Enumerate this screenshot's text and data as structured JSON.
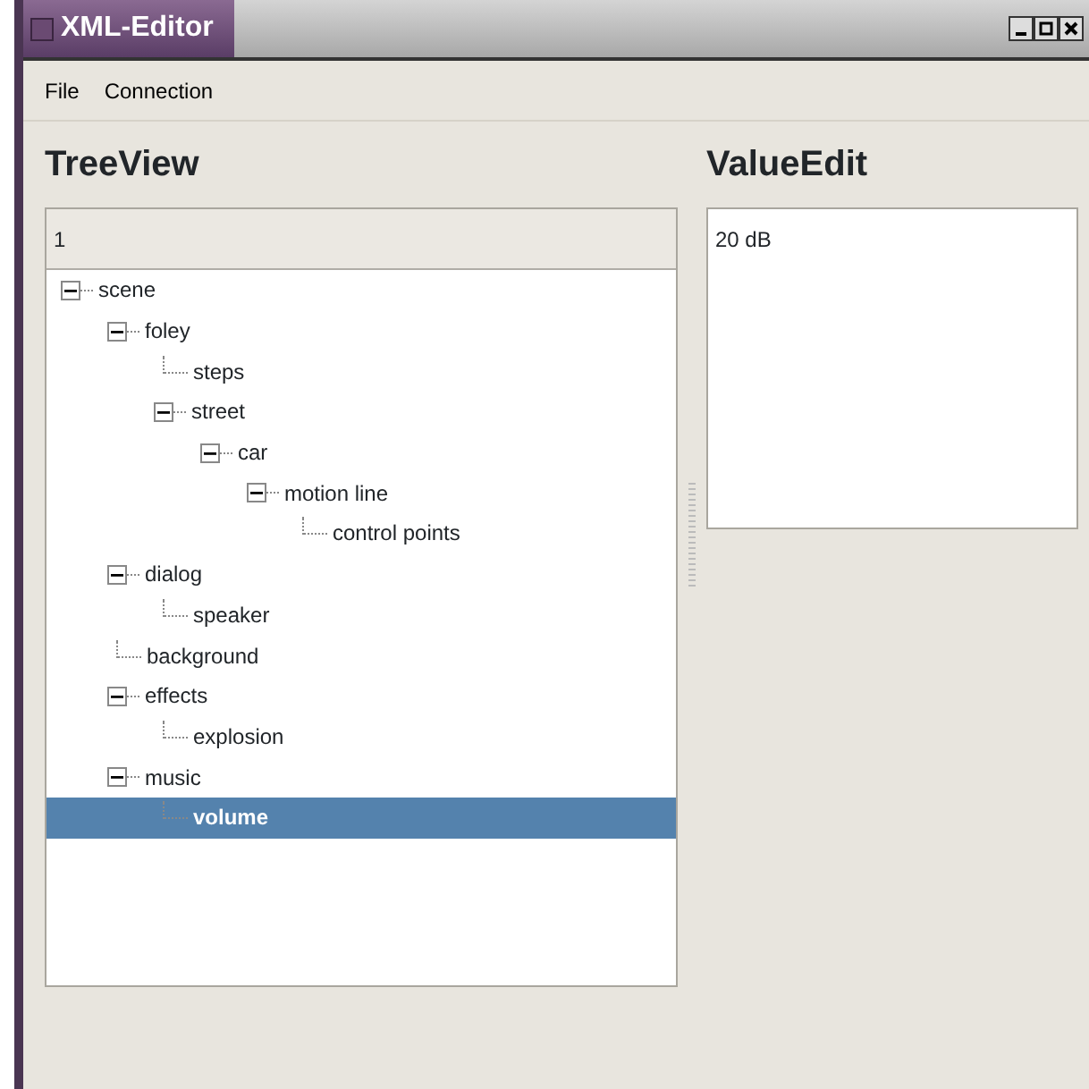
{
  "window": {
    "title": "XML-Editor"
  },
  "menu": [
    "File",
    "Connection"
  ],
  "tree_view": {
    "heading": "TreeView",
    "column_header": "1",
    "nodes": [
      {
        "label": "scene",
        "expanded": true,
        "selected": false,
        "children": [
          {
            "label": "foley",
            "expanded": true,
            "selected": false,
            "children": [
              {
                "label": "steps",
                "selected": false
              },
              {
                "label": "street",
                "expanded": true,
                "selected": false,
                "children": [
                  {
                    "label": "car",
                    "expanded": true,
                    "selected": false,
                    "children": [
                      {
                        "label": "motion line",
                        "expanded": true,
                        "selected": false,
                        "children": [
                          {
                            "label": "control points",
                            "selected": false
                          }
                        ]
                      }
                    ]
                  }
                ]
              }
            ]
          },
          {
            "label": "dialog",
            "expanded": true,
            "selected": false,
            "children": [
              {
                "label": "speaker",
                "selected": false
              }
            ]
          },
          {
            "label": "background",
            "selected": false
          },
          {
            "label": "effects",
            "expanded": true,
            "selected": false,
            "children": [
              {
                "label": "explosion",
                "selected": false
              }
            ]
          },
          {
            "label": "music",
            "expanded": true,
            "selected": false,
            "children": [
              {
                "label": "volume",
                "selected": true
              }
            ]
          }
        ]
      }
    ]
  },
  "value_edit": {
    "heading": "ValueEdit",
    "value": "20 dB"
  }
}
